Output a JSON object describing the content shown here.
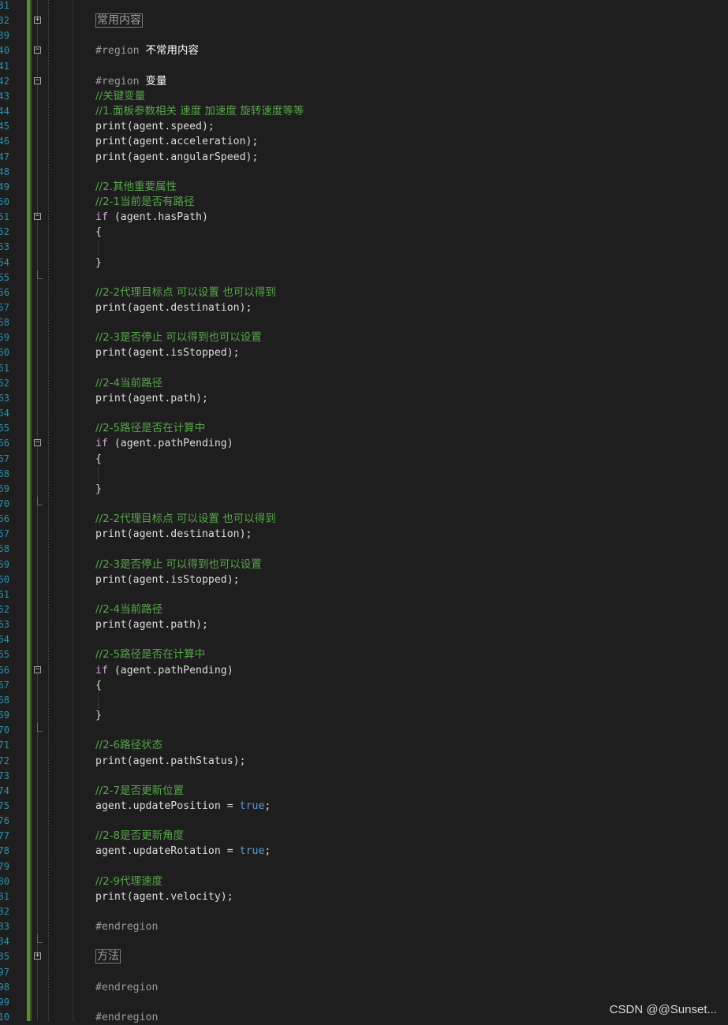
{
  "editor": {
    "lines": [
      {
        "num": "31",
        "tokens": [],
        "fold": ""
      },
      {
        "num": "32",
        "tokens": [
          {
            "t": "collapsed",
            "v": "常用内容"
          }
        ],
        "fold": "plus"
      },
      {
        "num": "39",
        "tokens": [],
        "fold": ""
      },
      {
        "num": "40",
        "tokens": [
          {
            "t": "preproc",
            "v": "#region "
          },
          {
            "t": "regionname",
            "v": "不常用内容"
          }
        ],
        "fold": "minus"
      },
      {
        "num": "41",
        "tokens": [],
        "fold": ""
      },
      {
        "num": "42",
        "tokens": [
          {
            "t": "preproc",
            "v": "#region "
          },
          {
            "t": "regionname",
            "v": "变量"
          }
        ],
        "fold": "minus"
      },
      {
        "num": "43",
        "tokens": [
          {
            "t": "comment",
            "v": "//关键变量"
          }
        ],
        "fold": ""
      },
      {
        "num": "44",
        "tokens": [
          {
            "t": "comment",
            "v": "//1.面板参数相关 速度 加速度 旋转速度等等"
          }
        ],
        "fold": ""
      },
      {
        "num": "45",
        "tokens": [
          {
            "t": "plain",
            "v": "print(agent.speed);"
          }
        ],
        "fold": ""
      },
      {
        "num": "46",
        "tokens": [
          {
            "t": "plain",
            "v": "print(agent.acceleration);"
          }
        ],
        "fold": ""
      },
      {
        "num": "47",
        "tokens": [
          {
            "t": "plain",
            "v": "print(agent.angularSpeed);"
          }
        ],
        "fold": ""
      },
      {
        "num": "48",
        "tokens": [],
        "fold": ""
      },
      {
        "num": "49",
        "tokens": [
          {
            "t": "comment",
            "v": "//2.其他重要属性"
          }
        ],
        "fold": ""
      },
      {
        "num": "50",
        "tokens": [
          {
            "t": "comment",
            "v": "//2-1当前是否有路径"
          }
        ],
        "fold": ""
      },
      {
        "num": "51",
        "tokens": [
          {
            "t": "keyword",
            "v": "if"
          },
          {
            "t": "plain",
            "v": " (agent.hasPath)"
          }
        ],
        "fold": "minus"
      },
      {
        "num": "52",
        "tokens": [
          {
            "t": "plain",
            "v": "{"
          }
        ],
        "fold": ""
      },
      {
        "num": "53",
        "tokens": [],
        "fold": ""
      },
      {
        "num": "54",
        "tokens": [
          {
            "t": "plain",
            "v": "}"
          }
        ],
        "fold": ""
      },
      {
        "num": "55",
        "tokens": [],
        "fold": "end"
      },
      {
        "num": "56",
        "tokens": [
          {
            "t": "comment",
            "v": "//2-2代理目标点 可以设置 也可以得到"
          }
        ],
        "fold": ""
      },
      {
        "num": "57",
        "tokens": [
          {
            "t": "plain",
            "v": "print(agent.destination);"
          }
        ],
        "fold": ""
      },
      {
        "num": "58",
        "tokens": [],
        "fold": ""
      },
      {
        "num": "59",
        "tokens": [
          {
            "t": "comment",
            "v": "//2-3是否停止 可以得到也可以设置"
          }
        ],
        "fold": ""
      },
      {
        "num": "60",
        "tokens": [
          {
            "t": "plain",
            "v": "print(agent.isStopped);"
          }
        ],
        "fold": ""
      },
      {
        "num": "61",
        "tokens": [],
        "fold": ""
      },
      {
        "num": "62",
        "tokens": [
          {
            "t": "comment",
            "v": "//2-4当前路径"
          }
        ],
        "fold": ""
      },
      {
        "num": "63",
        "tokens": [
          {
            "t": "plain",
            "v": "print(agent.path);"
          }
        ],
        "fold": ""
      },
      {
        "num": "64",
        "tokens": [],
        "fold": ""
      },
      {
        "num": "65",
        "tokens": [
          {
            "t": "comment",
            "v": "//2-5路径是否在计算中"
          }
        ],
        "fold": ""
      },
      {
        "num": "66",
        "tokens": [
          {
            "t": "keyword",
            "v": "if"
          },
          {
            "t": "plain",
            "v": " (agent.pathPending)"
          }
        ],
        "fold": "minus"
      },
      {
        "num": "67",
        "tokens": [
          {
            "t": "plain",
            "v": "{"
          }
        ],
        "fold": ""
      },
      {
        "num": "68",
        "tokens": [],
        "fold": ""
      },
      {
        "num": "69",
        "tokens": [
          {
            "t": "plain",
            "v": "}"
          }
        ],
        "fold": ""
      },
      {
        "num": "70",
        "tokens": [],
        "fold": "end"
      },
      {
        "num": "56",
        "tokens": [
          {
            "t": "comment",
            "v": "//2-2代理目标点 可以设置 也可以得到"
          }
        ],
        "fold": ""
      },
      {
        "num": "57",
        "tokens": [
          {
            "t": "plain",
            "v": "print(agent.destination);"
          }
        ],
        "fold": ""
      },
      {
        "num": "58",
        "tokens": [],
        "fold": ""
      },
      {
        "num": "59",
        "tokens": [
          {
            "t": "comment",
            "v": "//2-3是否停止 可以得到也可以设置"
          }
        ],
        "fold": ""
      },
      {
        "num": "60",
        "tokens": [
          {
            "t": "plain",
            "v": "print(agent.isStopped);"
          }
        ],
        "fold": ""
      },
      {
        "num": "61",
        "tokens": [],
        "fold": ""
      },
      {
        "num": "62",
        "tokens": [
          {
            "t": "comment",
            "v": "//2-4当前路径"
          }
        ],
        "fold": ""
      },
      {
        "num": "63",
        "tokens": [
          {
            "t": "plain",
            "v": "print(agent.path);"
          }
        ],
        "fold": ""
      },
      {
        "num": "64",
        "tokens": [],
        "fold": ""
      },
      {
        "num": "65",
        "tokens": [
          {
            "t": "comment",
            "v": "//2-5路径是否在计算中"
          }
        ],
        "fold": ""
      },
      {
        "num": "66",
        "tokens": [
          {
            "t": "keyword",
            "v": "if"
          },
          {
            "t": "plain",
            "v": " (agent.pathPending)"
          }
        ],
        "fold": "minus"
      },
      {
        "num": "67",
        "tokens": [
          {
            "t": "plain",
            "v": "{"
          }
        ],
        "fold": ""
      },
      {
        "num": "68",
        "tokens": [],
        "fold": ""
      },
      {
        "num": "69",
        "tokens": [
          {
            "t": "plain",
            "v": "}"
          }
        ],
        "fold": ""
      },
      {
        "num": "70",
        "tokens": [],
        "fold": "end"
      },
      {
        "num": "71",
        "tokens": [
          {
            "t": "comment",
            "v": "//2-6路径状态"
          }
        ],
        "fold": ""
      },
      {
        "num": "72",
        "tokens": [
          {
            "t": "plain",
            "v": "print(agent.pathStatus);"
          }
        ],
        "fold": ""
      },
      {
        "num": "73",
        "tokens": [],
        "fold": ""
      },
      {
        "num": "74",
        "tokens": [
          {
            "t": "comment",
            "v": "//2-7是否更新位置"
          }
        ],
        "fold": ""
      },
      {
        "num": "75",
        "tokens": [
          {
            "t": "plain",
            "v": "agent.updatePosition = "
          },
          {
            "t": "bool",
            "v": "true"
          },
          {
            "t": "plain",
            "v": ";"
          }
        ],
        "fold": ""
      },
      {
        "num": "76",
        "tokens": [],
        "fold": ""
      },
      {
        "num": "77",
        "tokens": [
          {
            "t": "comment",
            "v": "//2-8是否更新角度"
          }
        ],
        "fold": ""
      },
      {
        "num": "78",
        "tokens": [
          {
            "t": "plain",
            "v": "agent.updateRotation = "
          },
          {
            "t": "bool",
            "v": "true"
          },
          {
            "t": "plain",
            "v": ";"
          }
        ],
        "fold": ""
      },
      {
        "num": "79",
        "tokens": [],
        "fold": ""
      },
      {
        "num": "80",
        "tokens": [
          {
            "t": "comment",
            "v": "//2-9代理速度"
          }
        ],
        "fold": ""
      },
      {
        "num": "81",
        "tokens": [
          {
            "t": "plain",
            "v": "print(agent.velocity);"
          }
        ],
        "fold": ""
      },
      {
        "num": "82",
        "tokens": [],
        "fold": ""
      },
      {
        "num": "83",
        "tokens": [
          {
            "t": "preproc",
            "v": "#endregion"
          }
        ],
        "fold": ""
      },
      {
        "num": "84",
        "tokens": [],
        "fold": "end"
      },
      {
        "num": "85",
        "tokens": [
          {
            "t": "collapsed",
            "v": "方法"
          }
        ],
        "fold": "plus"
      },
      {
        "num": "97",
        "tokens": [],
        "fold": ""
      },
      {
        "num": "98",
        "tokens": [
          {
            "t": "preproc",
            "v": "#endregion"
          }
        ],
        "fold": ""
      },
      {
        "num": "99",
        "tokens": [],
        "fold": ""
      },
      {
        "num": "10",
        "tokens": [
          {
            "t": "preproc",
            "v": "#endregion"
          }
        ],
        "fold": ""
      }
    ]
  },
  "colors": {
    "background": "#1e1e1e",
    "line_number": "#2b91af",
    "comment": "#57a64a",
    "keyword": "#d8a0df",
    "bool": "#569cd6",
    "preprocessor": "#9b9b9b",
    "change_bar": "#5a8a32"
  },
  "watermark": "CSDN @@Sunset..."
}
